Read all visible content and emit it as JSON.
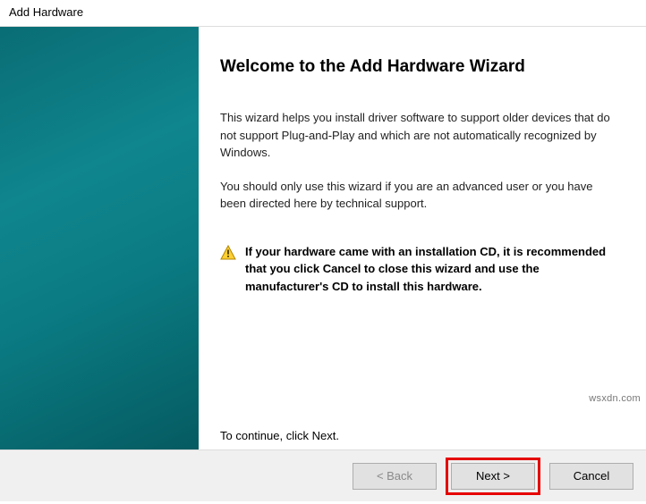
{
  "window": {
    "title": "Add Hardware"
  },
  "wizard": {
    "heading": "Welcome to the Add Hardware Wizard",
    "paragraph1": "This wizard helps you install driver software to support older devices that do not support Plug-and-Play and which are not automatically recognized by Windows.",
    "paragraph2": "You should only use this wizard if you are an advanced user or you have been directed here by technical support.",
    "warning_text": "If your hardware came with an installation CD, it is recommended that you click Cancel to close this wizard and use the manufacturer's CD to install this hardware.",
    "continue_hint": "To continue, click Next."
  },
  "buttons": {
    "back": "< Back",
    "next": "Next >",
    "cancel": "Cancel"
  },
  "watermark": "wsxdn.com"
}
